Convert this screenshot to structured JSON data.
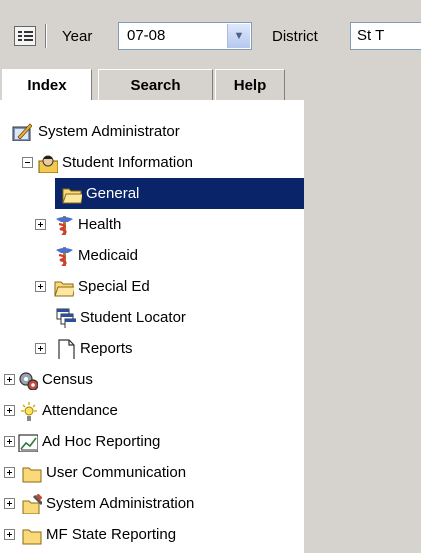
{
  "toolbar": {
    "year_label": "Year",
    "year_value": "07-08",
    "district_label": "District",
    "district_value": "St T"
  },
  "tabs": [
    {
      "label": "Index",
      "active": true
    },
    {
      "label": "Search",
      "active": false
    },
    {
      "label": "Help",
      "active": false
    }
  ],
  "tree": {
    "root": "System Administrator",
    "student_information": "Student Information",
    "general": "General",
    "health": "Health",
    "medicaid": "Medicaid",
    "special_ed": "Special Ed",
    "student_locator": "Student Locator",
    "reports": "Reports",
    "census": "Census",
    "attendance": "Attendance",
    "ad_hoc_reporting": "Ad Hoc Reporting",
    "user_communication": "User Communication",
    "system_administration": "System Administration",
    "mf_state_reporting": "MF State Reporting"
  },
  "colors": {
    "toolbar_bg": "#d6d3ce",
    "selection_bg": "#0a246a",
    "folder_yellow": "#f9d97a"
  },
  "icons": {
    "tree_toggle": "tree-view-icon",
    "folder": "folder-icon",
    "caduceus": "caduceus-icon",
    "document": "document-icon"
  }
}
